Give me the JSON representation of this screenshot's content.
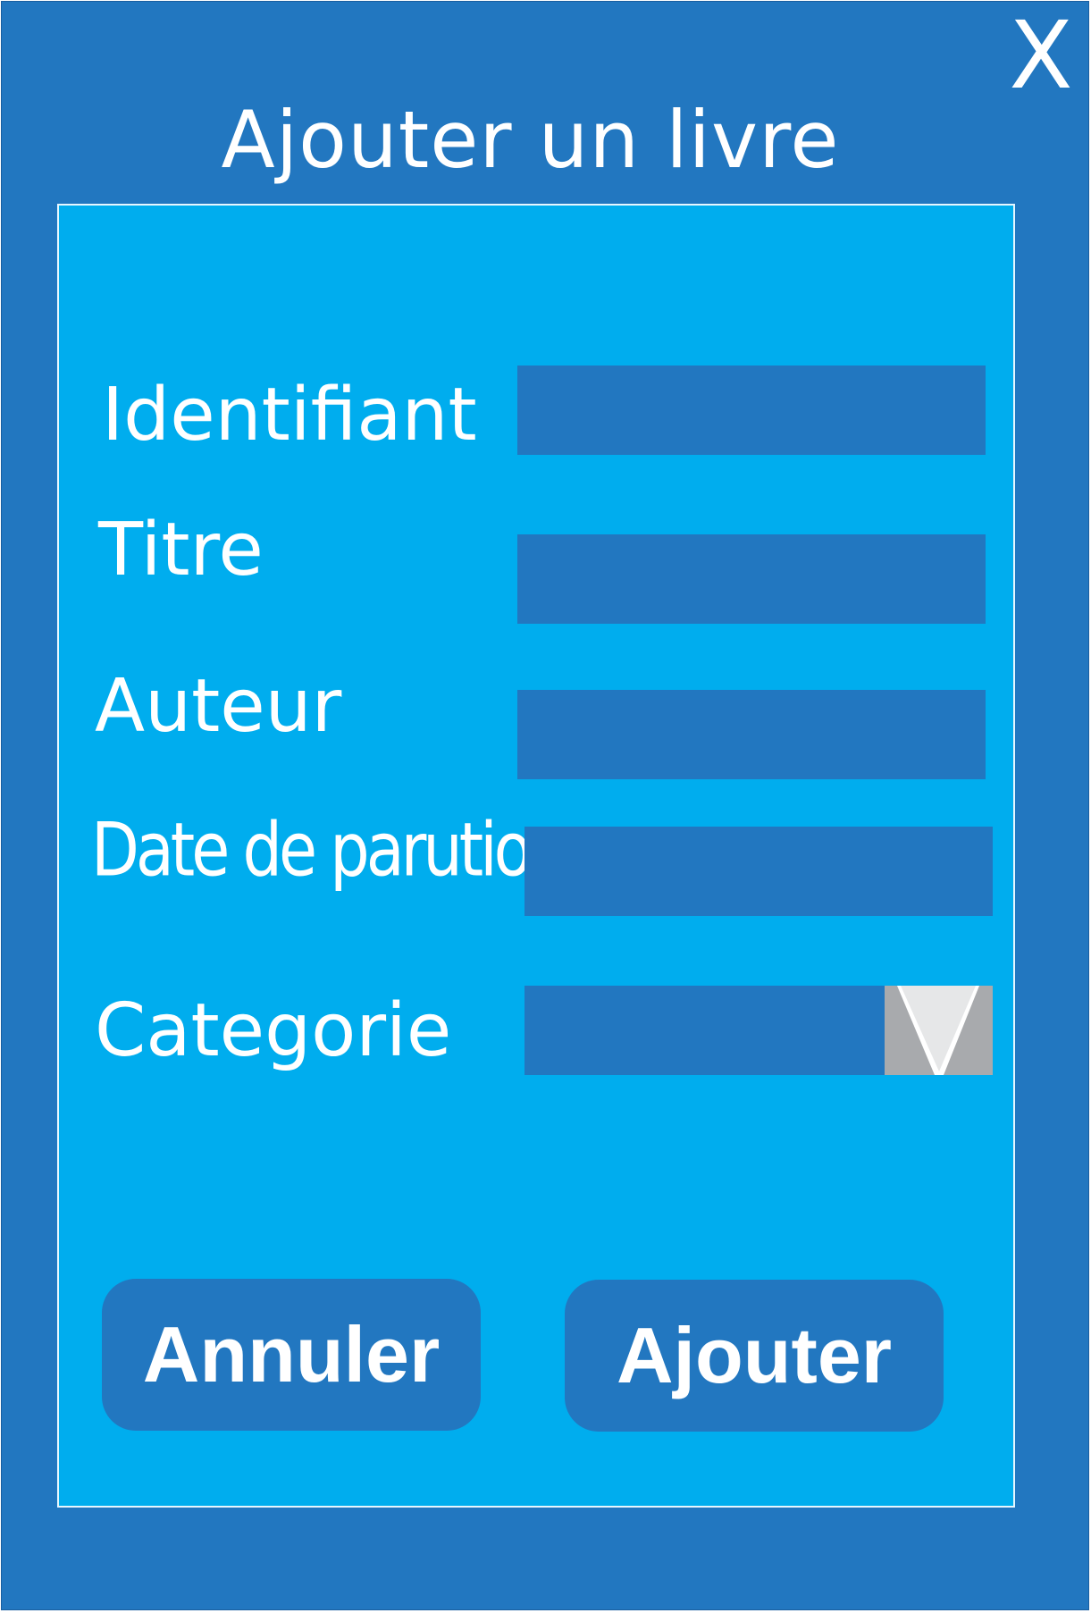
{
  "dialog": {
    "title": "Ajouter un livre",
    "close_label": "X"
  },
  "form": {
    "fields": [
      {
        "label": "Identifiant",
        "value": ""
      },
      {
        "label": "Titre",
        "value": ""
      },
      {
        "label": "Auteur",
        "value": ""
      },
      {
        "label": "Date de parution",
        "value": ""
      }
    ],
    "category": {
      "label": "Categorie",
      "selected": "",
      "arrow_icon": "triangle-down-icon"
    }
  },
  "buttons": {
    "cancel_label": "Annuler",
    "submit_label": "Ajouter"
  },
  "colors": {
    "window_bg": "#2277c0",
    "panel_bg": "#00adee",
    "field_bg": "#2277c0",
    "dropdown_button": "#a8aaad",
    "text": "#ffffff"
  }
}
